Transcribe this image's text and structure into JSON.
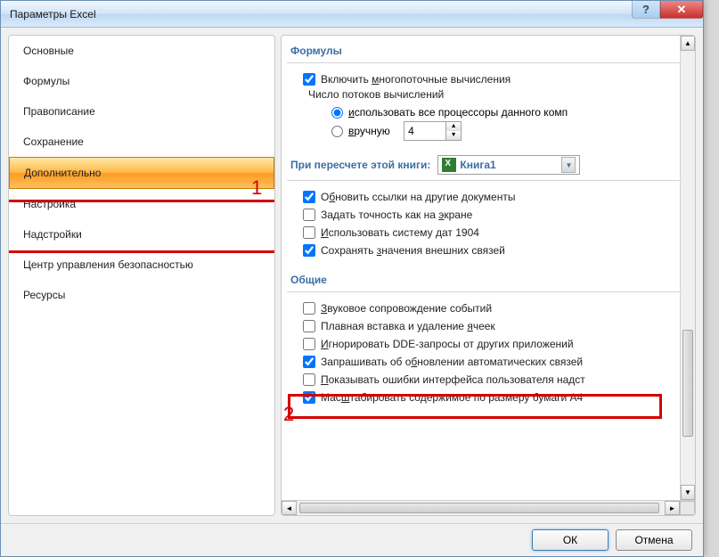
{
  "window": {
    "title": "Параметры Excel"
  },
  "annotations": {
    "num1": "1",
    "num2": "2"
  },
  "sidebar": {
    "items": [
      {
        "label": "Основные"
      },
      {
        "label": "Формулы"
      },
      {
        "label": "Правописание"
      },
      {
        "label": "Сохранение"
      },
      {
        "label": "Дополнительно",
        "selected": true
      },
      {
        "label": "Настройка"
      },
      {
        "label": "Надстройки"
      },
      {
        "label": "Центр управления безопасностью"
      },
      {
        "label": "Ресурсы"
      }
    ]
  },
  "sections": {
    "formulas": {
      "title": "Формулы",
      "enable_multithread": "Включить многопоточные вычисления",
      "threads_label": "Число потоков вычислений",
      "use_all": "использовать все процессоры данного комп",
      "manual": "вручную",
      "manual_value": "4"
    },
    "recalc": {
      "title": "При пересчете этой книги:",
      "book": "Книга1",
      "opts": [
        {
          "label": "Обновить ссылки на другие документы",
          "checked": true
        },
        {
          "label": "Задать точность как на экране",
          "checked": false
        },
        {
          "label": "Использовать систему дат 1904",
          "checked": false
        },
        {
          "label": "Сохранять значения внешних связей",
          "checked": true
        }
      ]
    },
    "general": {
      "title": "Общие",
      "opts": [
        {
          "label": "Звуковое сопровождение событий",
          "checked": false
        },
        {
          "label": "Плавная вставка и удаление ячеек",
          "checked": false
        },
        {
          "label": "Игнорировать DDE-запросы от других приложений",
          "checked": false
        },
        {
          "label": "Запрашивать об обновлении автоматических связей",
          "checked": true
        },
        {
          "label": "Показывать ошибки интерфейса пользователя надст",
          "checked": false
        },
        {
          "label": "Масштабировать содержимое по размеру бумаги A4",
          "checked": true
        }
      ]
    }
  },
  "footer": {
    "ok": "ОК",
    "cancel": "Отмена"
  }
}
